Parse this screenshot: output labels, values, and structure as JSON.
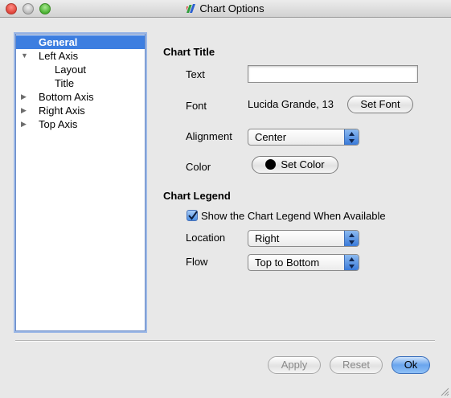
{
  "window": {
    "title": "Chart Options"
  },
  "tree": {
    "items": [
      {
        "label": "General",
        "selected": true,
        "indent": 1,
        "arrow": ""
      },
      {
        "label": "Left Axis",
        "selected": false,
        "indent": 1,
        "arrow": "▼"
      },
      {
        "label": "Layout",
        "selected": false,
        "indent": 2,
        "arrow": ""
      },
      {
        "label": "Title",
        "selected": false,
        "indent": 2,
        "arrow": ""
      },
      {
        "label": "Bottom Axis",
        "selected": false,
        "indent": 1,
        "arrow": "▶"
      },
      {
        "label": "Right Axis",
        "selected": false,
        "indent": 1,
        "arrow": "▶"
      },
      {
        "label": "Top Axis",
        "selected": false,
        "indent": 1,
        "arrow": "▶"
      }
    ]
  },
  "chart_title": {
    "heading": "Chart Title",
    "text_label": "Text",
    "text_value": "",
    "font_label": "Font",
    "font_value": "Lucida Grande, 13",
    "set_font_label": "Set Font",
    "alignment_label": "Alignment",
    "alignment_value": "Center",
    "color_label": "Color",
    "set_color_label": "Set Color",
    "color_value": "#000000"
  },
  "chart_legend": {
    "heading": "Chart Legend",
    "show_label": "Show the Chart Legend When Available",
    "show_checked": true,
    "location_label": "Location",
    "location_value": "Right",
    "flow_label": "Flow",
    "flow_value": "Top to Bottom"
  },
  "buttons": {
    "apply": "Apply",
    "reset": "Reset",
    "ok": "Ok"
  },
  "colors": {
    "selection": "#3d7ee0",
    "accent": "#6aa5ee"
  }
}
